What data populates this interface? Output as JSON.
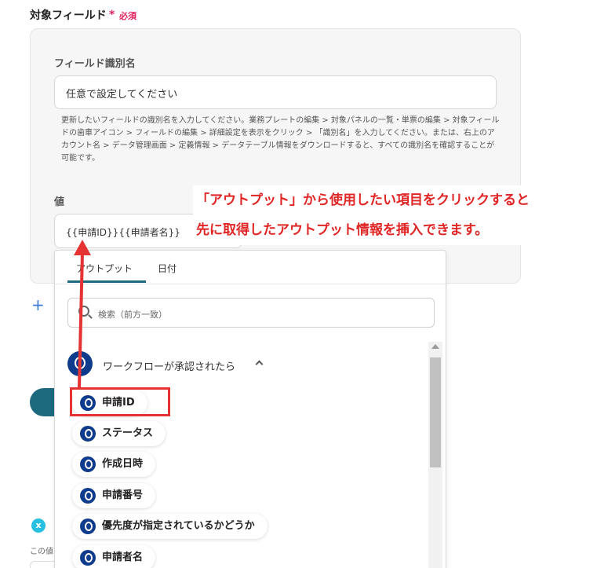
{
  "field": {
    "label": "対象フィールド",
    "required_star": "*",
    "required_text": "必須"
  },
  "field_name": {
    "label": "フィールド識別名",
    "placeholder": "任意で設定してください",
    "help": "更新したいフィールドの識別名を入力してください。業務プレートの編集 > 対象パネルの一覧・単票の編集 > 対象フィールドの歯車アイコン > フィールドの編集 > 詳細設定を表示をクリック > 「識別名」を入力してください。または、右上のアカウント名 > データ管理画面 > 定義情報 > データテーブル情報をダウンロードすると、すべての識別名を確認することが可能です。"
  },
  "value": {
    "label": "値",
    "content": "{{申請ID}}{{申請者名}}"
  },
  "dropdown": {
    "tabs": [
      "アウトプット",
      "日付"
    ],
    "search_placeholder": "検索（前方一致）",
    "group_title": "ワークフローが承認されたら",
    "items": [
      "申請ID",
      "ステータス",
      "作成日時",
      "申請番号",
      "優先度が指定されているかどうか",
      "申請者名"
    ]
  },
  "annotation": {
    "line1": "「アウトプット」から使用したい項目をクリックすると",
    "line2": "先に取得したアウトプット情報を挿入できます。"
  },
  "misc": {
    "plus": "+",
    "x_badge": "x",
    "under_text": "この値"
  },
  "colors": {
    "accent": "#1d6a7e",
    "required": "#e0245e",
    "annotation": "#e02525",
    "app_icon": "#0f3b8c"
  }
}
